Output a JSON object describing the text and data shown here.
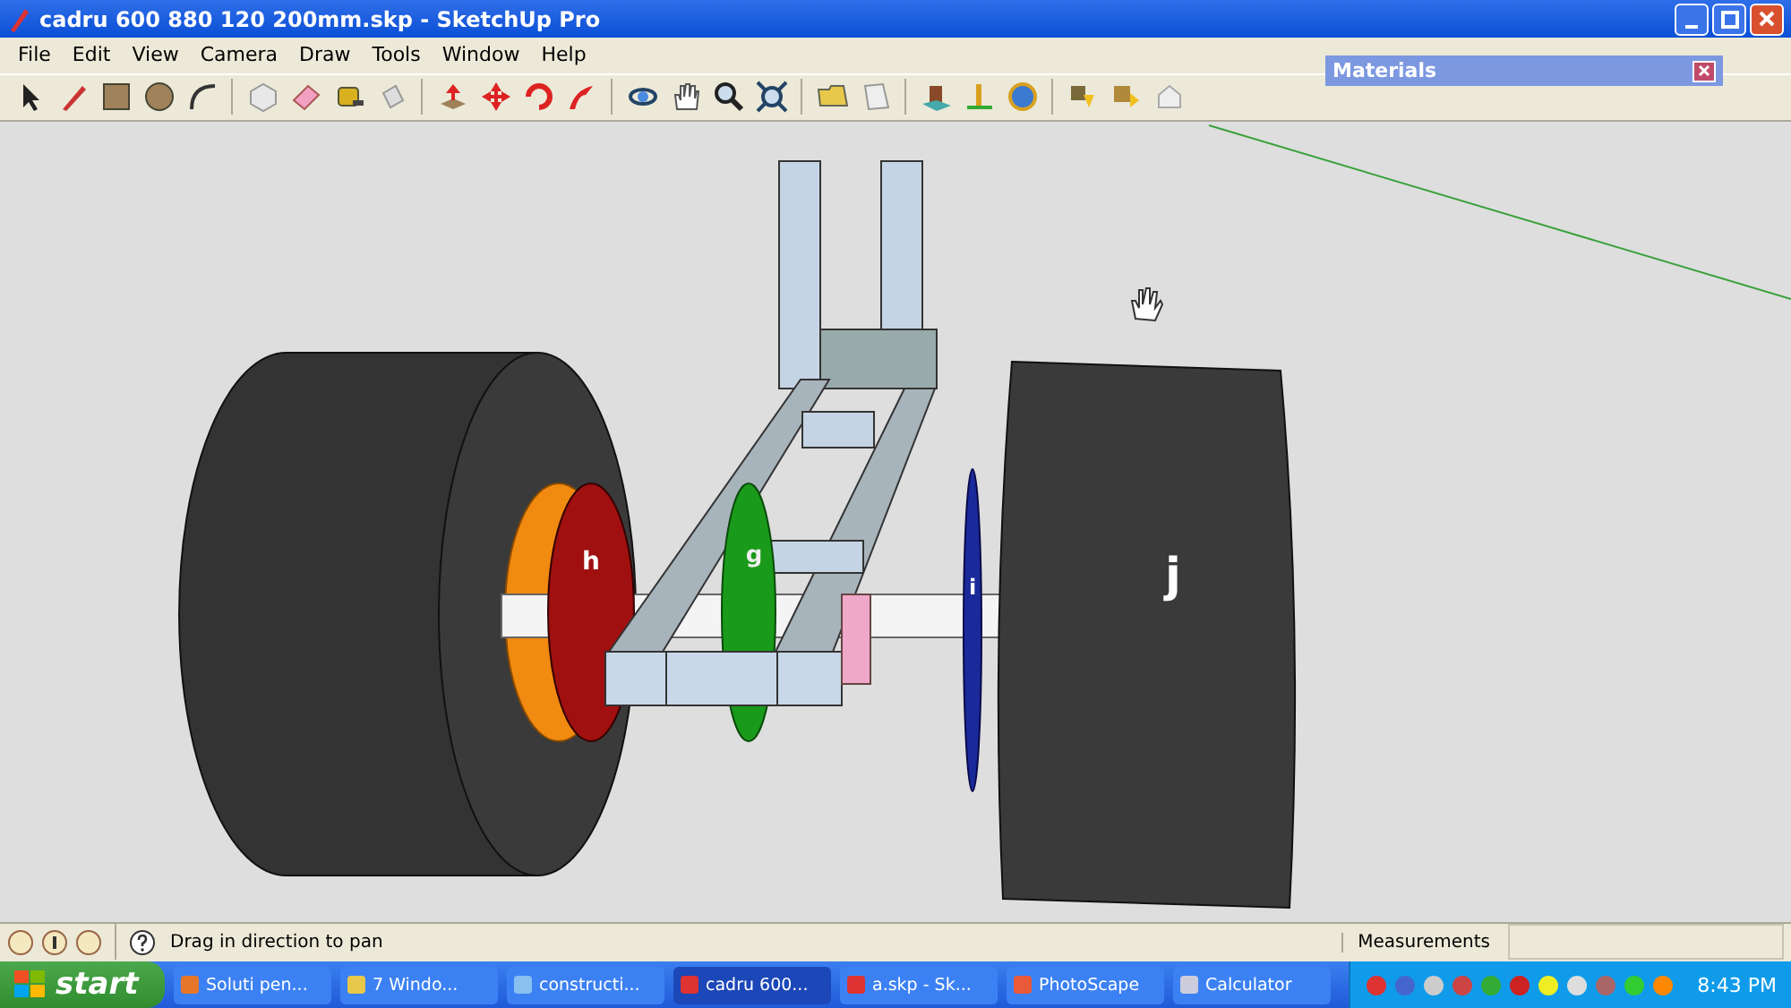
{
  "window": {
    "title": "cadru 600 880 120 200mm.skp - SketchUp Pro"
  },
  "menu": [
    "File",
    "Edit",
    "View",
    "Camera",
    "Draw",
    "Tools",
    "Window",
    "Help"
  ],
  "materials_panel": {
    "title": "Materials"
  },
  "model_labels": [
    "h",
    "g",
    "i",
    "j"
  ],
  "status_bar": {
    "hint": "Drag in direction to pan",
    "measurements_label": "Measurements"
  },
  "taskbar": {
    "start": "start",
    "tasks": [
      {
        "label": "Soluti pen...",
        "selected": false
      },
      {
        "label": "7 Windo...",
        "selected": false
      },
      {
        "label": "constructi...",
        "selected": false
      },
      {
        "label": "cadru 600...",
        "selected": true
      },
      {
        "label": "a.skp - Sk...",
        "selected": false
      },
      {
        "label": "PhotoScape",
        "selected": false
      },
      {
        "label": "Calculator",
        "selected": false
      }
    ],
    "clock": "8:43 PM"
  }
}
